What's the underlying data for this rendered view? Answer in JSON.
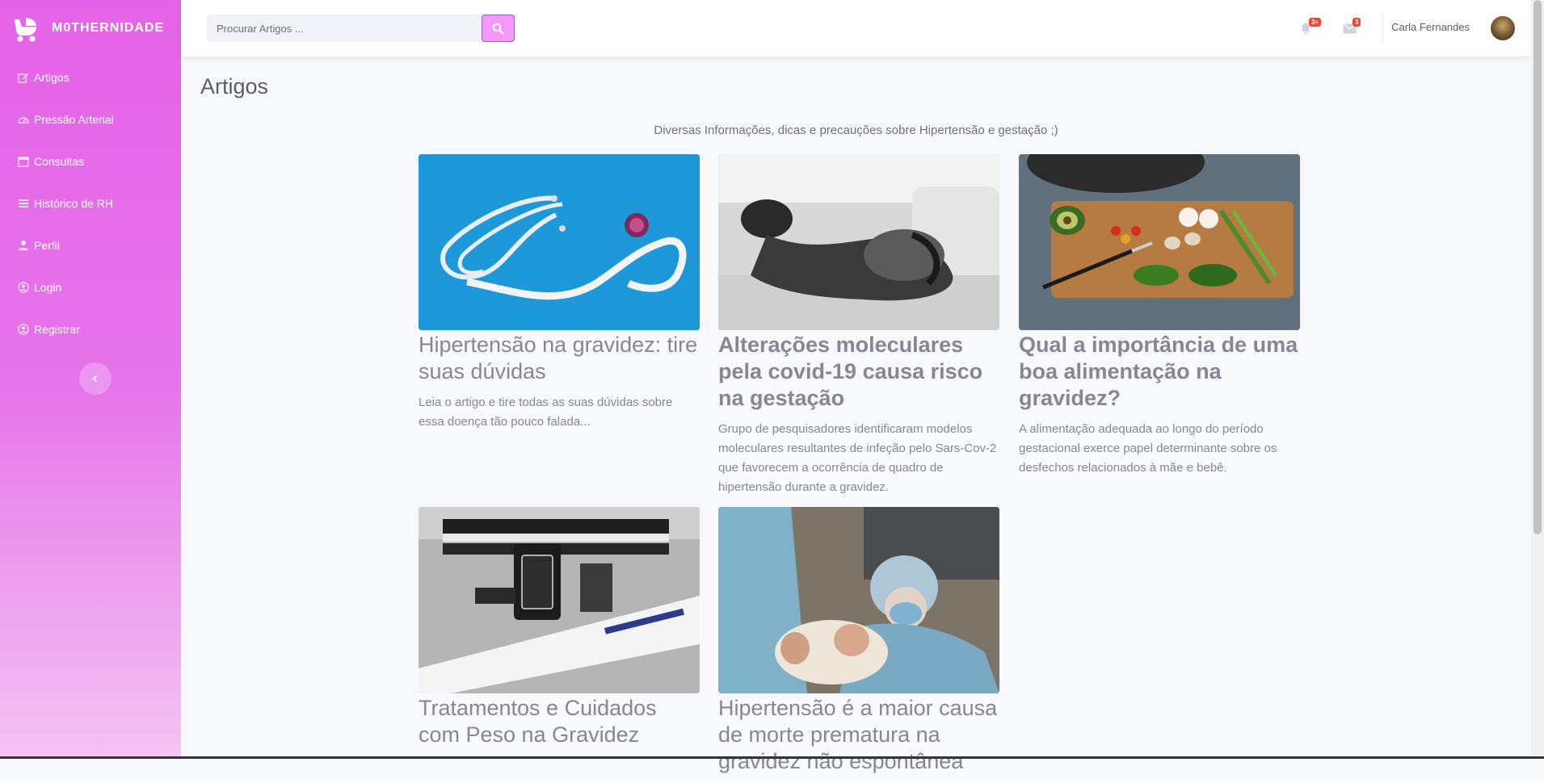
{
  "app": {
    "brand_name": "M0THERNIDADE"
  },
  "sidebar": {
    "items": [
      {
        "label": "Artigos",
        "icon": "edit-icon"
      },
      {
        "label": "Pressão Arterial",
        "icon": "tachometer-icon"
      },
      {
        "label": "Consultas",
        "icon": "calendar-icon"
      },
      {
        "label": "Histórico de RH",
        "icon": "list-icon"
      },
      {
        "label": "Perfil",
        "icon": "user-icon"
      },
      {
        "label": "Login",
        "icon": "user-circle-icon"
      },
      {
        "label": "Registrar",
        "icon": "user-circle-icon"
      }
    ]
  },
  "topbar": {
    "search_placeholder": "Procurar Artigos ...",
    "alerts_badge": "3+",
    "messages_badge": "3",
    "username": "Carla Fernandes"
  },
  "main": {
    "title": "Artigos",
    "subtitle": "Diversas Informações, dicas e precauções sobre Hipertensão e gestação ;)",
    "articles": [
      {
        "title": "Hipertensão na gravidez: tire suas dúvidas",
        "description": "Leia o artigo e tire todas as suas dúvidas sobre essa doença tão pouco falada..."
      },
      {
        "title": "Alterações moleculares pela covid-19 causa risco na gestação",
        "description": "Grupo de pesquisadores identificaram modelos moleculares resultantes de infeção pelo Sars-Cov-2 que favorecem a ocorrência de quadro de hipertensão durante a gravidez."
      },
      {
        "title": "Qual a importância de uma boa alimentação na gravidez?",
        "description": "A alimentação adequada ao longo do período gestacional exerce papel determinante sobre os desfechos relacionados à mãe e bebê."
      },
      {
        "title": "Tratamentos e Cuidados com Peso na Gravidez",
        "description": ""
      },
      {
        "title": "Hipertensão é a maior causa de morte prematura na gravidez não espontânea",
        "description": ""
      }
    ]
  },
  "colors": {
    "sidebar_top": "#e563e8",
    "sidebar_bottom": "#f3c4f2",
    "search_button": "#f598f7",
    "badge": "#e74a3b"
  }
}
